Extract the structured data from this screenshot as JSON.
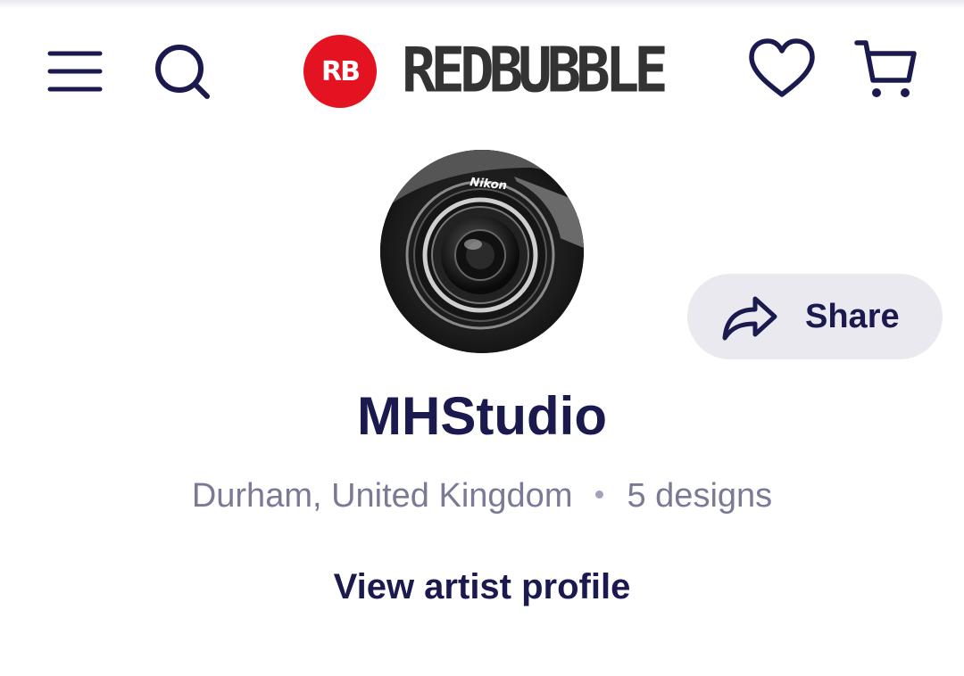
{
  "header": {
    "logo_badge": "RB",
    "logo_text": "REDBUBBLE",
    "icons": [
      "hamburger-menu-icon",
      "search-icon",
      "heart-icon",
      "cart-icon"
    ]
  },
  "artist": {
    "avatar_alt": "Nikon",
    "name": "MHStudio",
    "location": "Durham, United Kingdom",
    "designs": "5 designs",
    "profile_link": "View artist profile"
  },
  "share": {
    "label": "Share"
  },
  "colors": {
    "brand_red": "#e41321",
    "ink": "#1b1a4f",
    "muted": "#7b7a96",
    "pill_bg": "#ebe9f0"
  }
}
